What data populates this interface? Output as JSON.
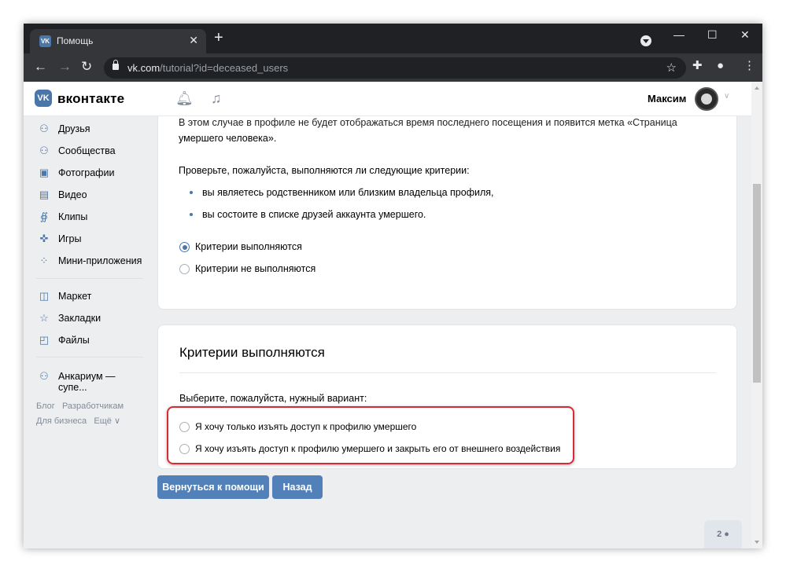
{
  "browser": {
    "tab_title": "Помощь",
    "tab_favicon": "VK",
    "url_host": "vk.com",
    "url_path": "/tutorial?id=deceased_users"
  },
  "header": {
    "logo_text": "VK",
    "brand": "вконтакте",
    "user_name": "Максим"
  },
  "sidebar": {
    "items": [
      {
        "label": "Друзья",
        "icon": "friends-icon"
      },
      {
        "label": "Сообщества",
        "icon": "communities-icon"
      },
      {
        "label": "Фотографии",
        "icon": "photos-icon"
      },
      {
        "label": "Видео",
        "icon": "video-icon"
      },
      {
        "label": "Клипы",
        "icon": "clips-icon"
      },
      {
        "label": "Игры",
        "icon": "games-icon"
      },
      {
        "label": "Мини-приложения",
        "icon": "mini-apps-icon"
      },
      {
        "label": "Маркет",
        "icon": "market-icon"
      },
      {
        "label": "Закладки",
        "icon": "bookmarks-icon"
      },
      {
        "label": "Файлы",
        "icon": "files-icon"
      },
      {
        "label": "Анкариум — супе...",
        "icon": "community-icon"
      }
    ],
    "footer": {
      "blog": "Блог",
      "developers": "Разработчикам",
      "business": "Для бизнеса",
      "more": "Ещё"
    }
  },
  "card1": {
    "intro_line1": "В этом случае в профиле не будет отображаться время последнего посещения и появится метка «Страница",
    "intro_line2": "умершего человека».",
    "check_prompt": "Проверьте, пожалуйста, выполняются ли следующие критерии:",
    "criteria": [
      "вы являетесь родственником или близким владельца профиля,",
      "вы состоите в списке друзей аккаунта умершего."
    ],
    "options": [
      {
        "label": "Критерии выполняются",
        "selected": true
      },
      {
        "label": "Критерии не выполняются",
        "selected": false
      }
    ]
  },
  "card2": {
    "title": "Критерии выполняются",
    "prompt": "Выберите, пожалуйста, нужный вариант:",
    "options": [
      {
        "label": "Я хочу только изъять доступ к профилю умершего",
        "selected": false
      },
      {
        "label": "Я хочу изъять доступ к профилю умершего и закрыть его от внешнего воздействия",
        "selected": false
      }
    ]
  },
  "buttons": {
    "back_to_help": "Вернуться к помощи",
    "back": "Назад"
  },
  "people_badge": "2",
  "colors": {
    "accent": "#4a76a8",
    "button": "#5181b8",
    "highlight": "#d62a35"
  }
}
